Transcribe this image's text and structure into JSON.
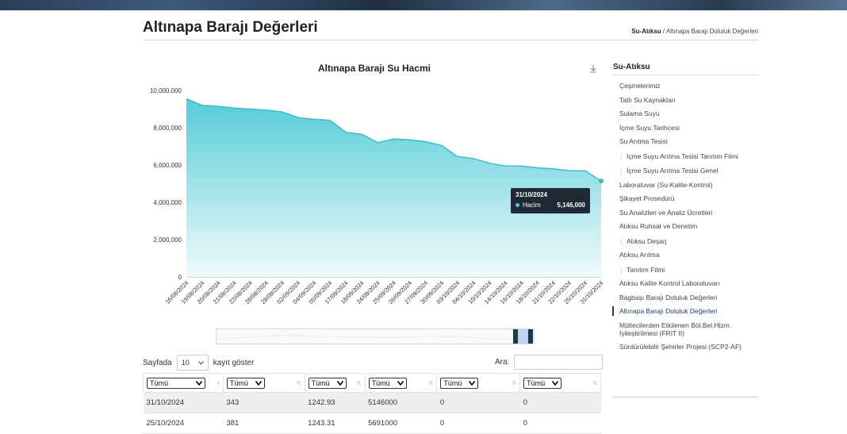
{
  "page": {
    "title": "Altınapa Barajı Değerleri",
    "breadcrumb_root": "Su-Atıksu",
    "breadcrumb_sep": "/",
    "breadcrumb_current": "Altınapa Barajı Doluluk Değerleri"
  },
  "chart_data": {
    "type": "area",
    "title": "Altınapa Barajı Su Hacmi",
    "xlabel": "",
    "ylabel": "",
    "ylim": [
      0,
      10000000
    ],
    "yticks": [
      "0",
      "2,000,000",
      "4,000,000",
      "6,000,000",
      "8,000,000",
      "10,000,000"
    ],
    "ytick_values": [
      0,
      2000000,
      4000000,
      6000000,
      8000000,
      10000000
    ],
    "grid": false,
    "color": "#4cc9d6",
    "x": [
      "16/08/2024",
      "19/08/2024",
      "20/08/2024",
      "21/08/2024",
      "22/08/2024",
      "26/08/2024",
      "28/08/2024",
      "02/09/2024",
      "04/09/2024",
      "05/09/2024",
      "17/09/2024",
      "18/09/2024",
      "24/09/2024",
      "25/09/2024",
      "26/09/2024",
      "27/09/2024",
      "30/09/2024",
      "03/10/2024",
      "04/10/2024",
      "10/10/2024",
      "14/10/2024",
      "16/10/2024",
      "18/10/2024",
      "21/10/2024",
      "22/10/2024",
      "25/10/2024",
      "31/10/2024"
    ],
    "series": [
      {
        "name": "Hacim",
        "values": [
          9550000,
          9200000,
          9150000,
          9050000,
          9000000,
          8950000,
          8850000,
          8550000,
          8450000,
          8400000,
          7750000,
          7650000,
          7200000,
          7400000,
          7350000,
          7250000,
          7050000,
          6450000,
          6350000,
          6100000,
          5950000,
          5950000,
          5850000,
          5800000,
          5700000,
          5691000,
          5146000
        ]
      }
    ],
    "tooltip": {
      "date": "31/10/2024",
      "series": "Hacim",
      "value": "5,146,000"
    }
  },
  "icons": {
    "download": "download-icon",
    "chevron": "chevron-down-icon"
  },
  "table_controls": {
    "length_label_before": "Sayfada",
    "length_value": "10",
    "length_label_after": "kayıt göster",
    "search_label": "Ara:"
  },
  "table": {
    "filters": [
      "Tümü",
      "Tümü",
      "Tümü",
      "Tümü",
      "Tümü",
      "Tümü"
    ],
    "rows": [
      [
        "31/10/2024",
        "343",
        "1242.93",
        "5146000",
        "0",
        "0"
      ],
      [
        "25/10/2024",
        "381",
        "1243.31",
        "5691000",
        "0",
        "0"
      ]
    ]
  },
  "sidebar": {
    "title": "Su-Atıksu",
    "items": [
      {
        "label": "Çeşmelerimiz",
        "level": 0
      },
      {
        "label": "Tatlı Su Kaynakları",
        "level": 0
      },
      {
        "label": "Sulama Suyu",
        "level": 0
      },
      {
        "label": "İçme Suyu Tarihcesi",
        "level": 0
      },
      {
        "label": "Su Arıtma Tesisi",
        "level": 0
      },
      {
        "label": "İçme Suyu Arıtma Tesisi Tanıtım Filmi",
        "level": 1
      },
      {
        "label": "İçme Suyu Arıtma Tesisi Genel",
        "level": 1
      },
      {
        "label": "Laboratuvar (Su-Kalite-Kontrol)",
        "level": 0
      },
      {
        "label": "Şikayet Prosedürü",
        "level": 0
      },
      {
        "label": "Su Analizleri ve Analiz Ücretleri",
        "level": 0
      },
      {
        "label": "Atıksu Ruhsat ve Denetim",
        "level": 0
      },
      {
        "label": "Atıksu Deşarj",
        "level": 1
      },
      {
        "label": "Atıksu Arıtma",
        "level": 0
      },
      {
        "label": "Tanıtım Filmi",
        "level": 1
      },
      {
        "label": "Atıksu Kalite Kontrol Laboratuvarı",
        "level": 0
      },
      {
        "label": "Bagbaşı Barajı Doluluk Değerleri",
        "level": 0
      },
      {
        "label": "Altınapa Barajı Doluluk Değerleri",
        "level": 0,
        "active": true
      },
      {
        "label": "Mültecilerden Etkilenen Böl.Bel.Hizm.",
        "label2": "İyileştirilmesi (FRIT II)",
        "level": 0
      },
      {
        "label": "Sürdürülebilir Şehirler Projesi (SCP2-AF)",
        "level": 0
      }
    ]
  }
}
